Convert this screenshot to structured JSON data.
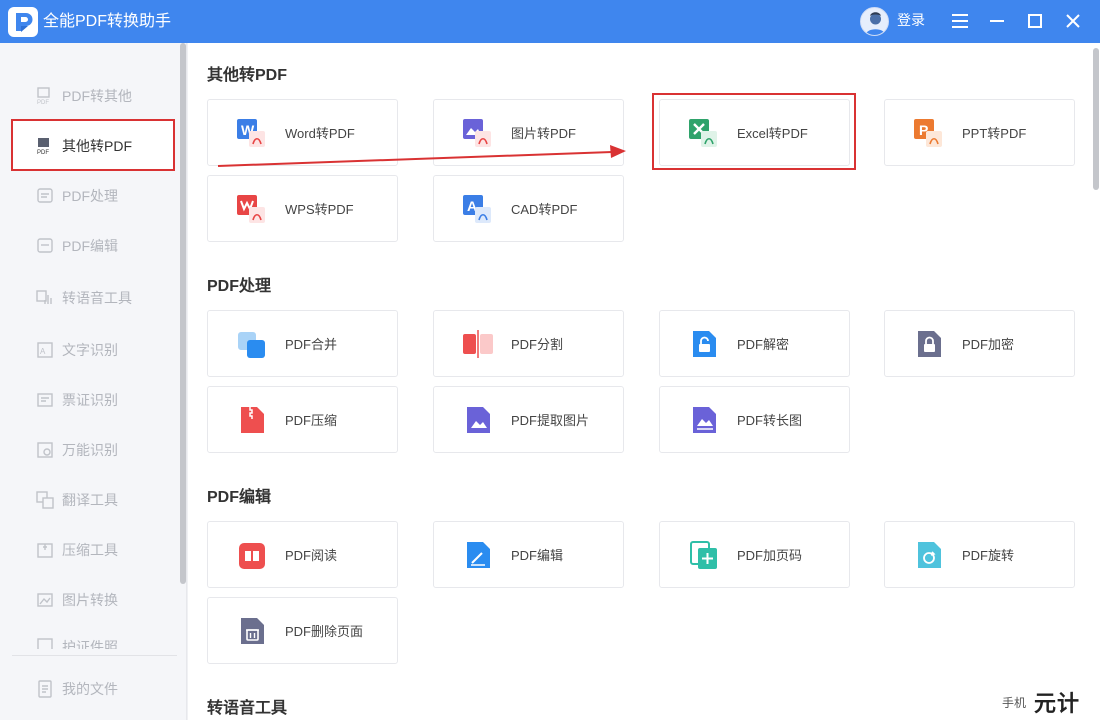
{
  "app": {
    "title": "全能PDF转换助手",
    "login_label": "登录",
    "brand_color": "#3f86ee"
  },
  "window_controls": [
    "menu-icon",
    "minimize-icon",
    "maximize-icon",
    "close-icon"
  ],
  "sidebar": {
    "items": [
      {
        "label": "PDF转其他",
        "icon": "pdf-export-icon"
      },
      {
        "label": "其他转PDF",
        "icon": "pdf-import-icon",
        "active": true
      },
      {
        "label": "PDF处理",
        "icon": "pdf-process-icon"
      },
      {
        "label": "PDF编辑",
        "icon": "pdf-edit-icon"
      },
      {
        "label": "转语音工具",
        "icon": "voice-icon"
      },
      {
        "label": "文字识别",
        "icon": "ocr-icon"
      },
      {
        "label": "票证识别",
        "icon": "ticket-icon"
      },
      {
        "label": "万能识别",
        "icon": "scan-icon"
      },
      {
        "label": "翻译工具",
        "icon": "translate-icon"
      },
      {
        "label": "压缩工具",
        "icon": "compress-icon"
      },
      {
        "label": "图片转换",
        "icon": "image-convert-icon"
      },
      {
        "label": "护证件照",
        "icon": "id-photo-icon"
      }
    ],
    "footer_label": "我的文件"
  },
  "sections": [
    {
      "title": "其他转PDF",
      "cards": [
        {
          "label": "Word转PDF",
          "icon": "word-icon"
        },
        {
          "label": "图片转PDF",
          "icon": "image-icon"
        },
        {
          "label": "Excel转PDF",
          "icon": "excel-icon"
        },
        {
          "label": "PPT转PDF",
          "icon": "ppt-icon"
        },
        {
          "label": "WPS转PDF",
          "icon": "wps-icon"
        },
        {
          "label": "CAD转PDF",
          "icon": "cad-icon"
        }
      ]
    },
    {
      "title": "PDF处理",
      "cards": [
        {
          "label": "PDF合并",
          "icon": "merge-icon"
        },
        {
          "label": "PDF分割",
          "icon": "split-icon"
        },
        {
          "label": "PDF解密",
          "icon": "unlock-icon"
        },
        {
          "label": "PDF加密",
          "icon": "lock-icon"
        },
        {
          "label": "PDF压缩",
          "icon": "compress-file-icon"
        },
        {
          "label": "PDF提取图片",
          "icon": "extract-image-icon"
        },
        {
          "label": "PDF转长图",
          "icon": "long-image-icon"
        }
      ]
    },
    {
      "title": "PDF编辑",
      "cards": [
        {
          "label": "PDF阅读",
          "icon": "read-icon"
        },
        {
          "label": "PDF编辑",
          "icon": "edit-icon"
        },
        {
          "label": "PDF加页码",
          "icon": "page-number-icon"
        },
        {
          "label": "PDF旋转",
          "icon": "rotate-icon"
        },
        {
          "label": "PDF删除页面",
          "icon": "delete-page-icon"
        }
      ]
    },
    {
      "title": "转语音工具",
      "cards": []
    }
  ],
  "watermark": {
    "small": "手机",
    "big": "元计算"
  },
  "highlight_color": "#d93233"
}
